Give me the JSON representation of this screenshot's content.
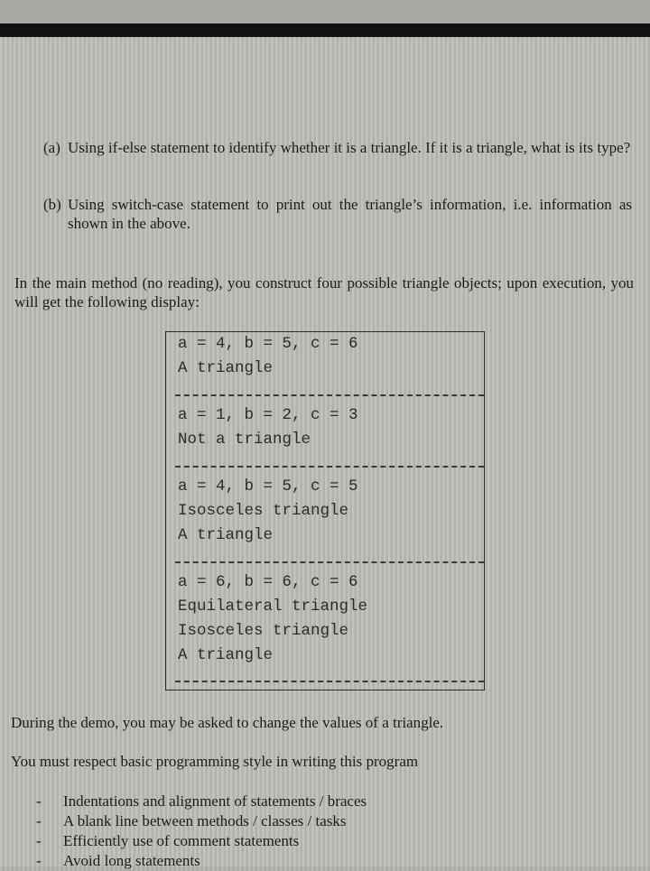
{
  "items": [
    {
      "marker": "(a)",
      "text": "Using if-else statement to identify whether it is a triangle. If it is a triangle, what is its type?"
    },
    {
      "marker": "(b)",
      "text": "Using switch-case statement to print out the triangle’s information, i.e. information as shown in the above."
    }
  ],
  "intro": "In the main method (no reading), you construct four possible triangle objects; upon execution, you will get the following display:",
  "output": {
    "blocks": [
      {
        "lines": [
          "a = 4, b = 5, c = 6",
          "A triangle"
        ]
      },
      {
        "lines": [
          "a = 1, b = 2, c = 3",
          "Not a triangle"
        ]
      },
      {
        "lines": [
          "a = 4, b = 5, c = 5",
          "Isosceles triangle",
          "A triangle"
        ]
      },
      {
        "lines": [
          "a = 6, b = 6, c = 6",
          "Equilateral triangle",
          "Isosceles triangle",
          "A triangle"
        ]
      }
    ]
  },
  "demo_note": "During the demo, you may be asked to change the values of a triangle.",
  "style_note": "You must respect basic programming style in writing this program",
  "style_rules": {
    "bullet": "-",
    "items": [
      "Indentations and alignment of statements / braces",
      "A blank line between methods / classes / tasks",
      "Efficiently use of comment statements",
      "Avoid long statements"
    ]
  }
}
